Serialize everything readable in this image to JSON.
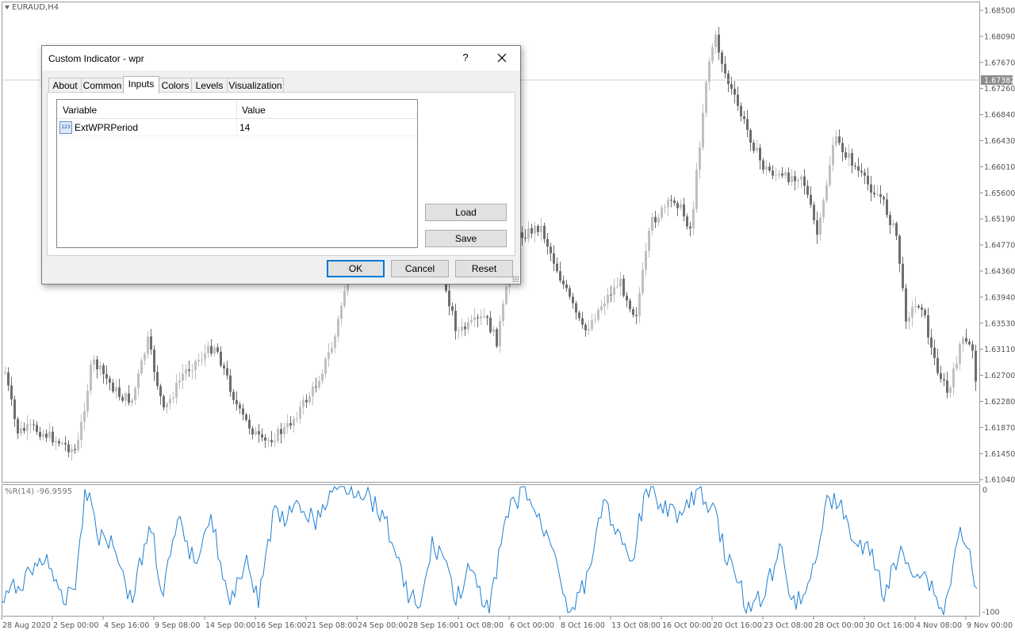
{
  "chart": {
    "symbol": "EURAUD,H4",
    "indicator_label": "%R(14) -96.9595",
    "current_price": "1.67382",
    "price_ticks": [
      "1.68500",
      "1.68090",
      "1.67670",
      "1.67260",
      "1.66840",
      "1.66430",
      "1.66010",
      "1.65600",
      "1.65190",
      "1.64770",
      "1.64360",
      "1.63940",
      "1.63530",
      "1.63110",
      "1.62700",
      "1.62280",
      "1.61870",
      "1.61450",
      "1.61040"
    ],
    "indicator_ticks": [
      "0",
      "-100"
    ],
    "time_ticks": [
      "28 Aug 2020",
      "2 Sep 00:00",
      "4 Sep 16:00",
      "9 Sep 08:00",
      "14 Sep 00:00",
      "16 Sep 16:00",
      "21 Sep 08:00",
      "24 Sep 00:00",
      "28 Sep 16:00",
      "1 Oct 08:00",
      "6 Oct 00:00",
      "8 Oct 16:00",
      "13 Oct 08:00",
      "16 Oct 00:00",
      "20 Oct 16:00",
      "23 Oct 08:00",
      "28 Oct 00:00",
      "30 Oct 16:00",
      "4 Nov 08:00",
      "9 Nov 00:00"
    ],
    "colors": {
      "bull": "#c0c0c0",
      "bear": "#6e6e6e",
      "wpr_line": "#1e7fd1",
      "price_line": "#c8c8c8",
      "price_label_bg": "#8c8c8c"
    }
  },
  "dialog": {
    "title": "Custom Indicator - wpr",
    "help_label": "?",
    "close_icon": "close-icon",
    "tabs": [
      {
        "label": "About"
      },
      {
        "label": "Common"
      },
      {
        "label": "Inputs",
        "active": true
      },
      {
        "label": "Colors"
      },
      {
        "label": "Levels"
      },
      {
        "label": "Visualization"
      }
    ],
    "grid": {
      "col_variable": "Variable",
      "col_value": "Value",
      "rows": [
        {
          "icon": "integer-icon",
          "icon_text": "123",
          "name": "ExtWPRPeriod",
          "value": "14"
        }
      ]
    },
    "buttons": {
      "load": "Load",
      "save": "Save",
      "ok": "OK",
      "cancel": "Cancel",
      "reset": "Reset"
    }
  }
}
